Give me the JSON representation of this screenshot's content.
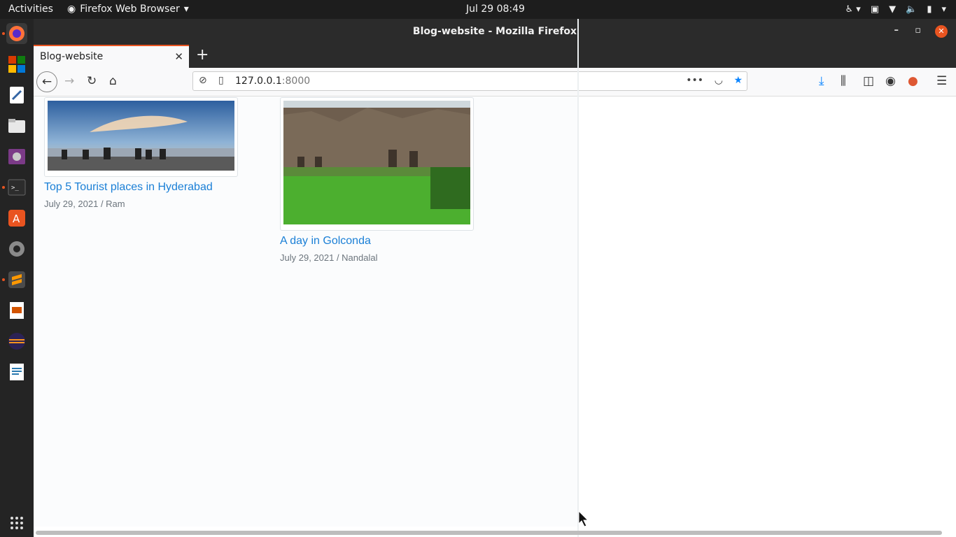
{
  "topbar": {
    "activities": "Activities",
    "app_name": "Firefox Web Browser",
    "clock": "Jul 29  08:49"
  },
  "window": {
    "title": "Blog-website - Mozilla Firefox"
  },
  "tabs": [
    {
      "label": "Blog-website"
    }
  ],
  "urlbar": {
    "host": "127.0.0.1",
    "port": ":8000"
  },
  "posts": [
    {
      "title": "Top 5 Tourist places in Hyderabad",
      "meta": "July 29, 2021 / Ram"
    },
    {
      "title": "A day in Golconda",
      "meta": "July 29, 2021 / Nandalal"
    }
  ],
  "colors": {
    "accent": "#e95420",
    "link": "#1a7fd6",
    "bookmark_star": "#0a84ff"
  }
}
